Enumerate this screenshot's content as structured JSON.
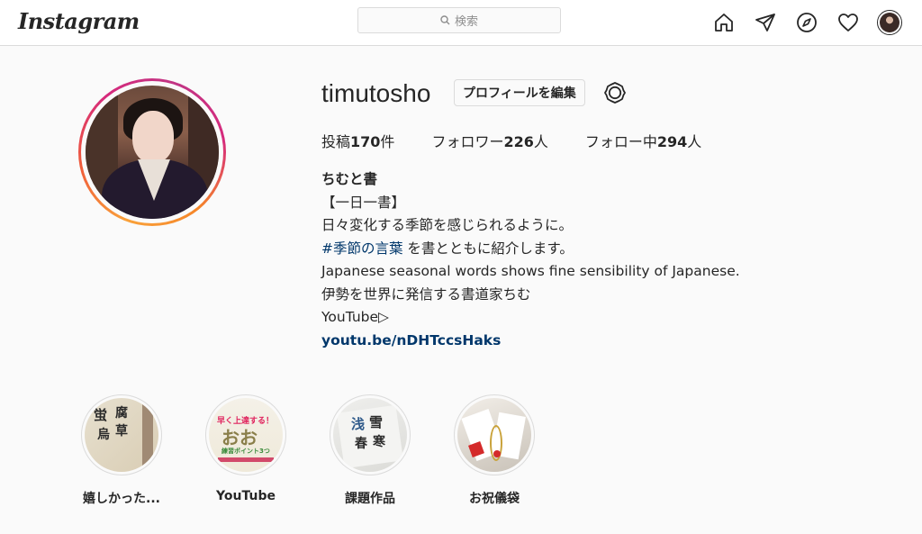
{
  "nav": {
    "logo": "Instagram",
    "search_placeholder": "検索",
    "icons": [
      "home-icon",
      "direct-icon",
      "explore-icon",
      "activity-heart-icon",
      "profile-avatar"
    ]
  },
  "profile": {
    "username": "timutosho",
    "edit_button": "プロフィールを編集",
    "stats": [
      {
        "label": "投稿",
        "value": "170",
        "suffix": "件"
      },
      {
        "label": "フォロワー",
        "value": "226",
        "suffix": "人"
      },
      {
        "label": "フォロー中",
        "value": "294",
        "suffix": "人"
      }
    ],
    "bio": {
      "name": "ちむと書",
      "line1": "【一日一書】",
      "line2": "日々変化する季節を感じられるように。",
      "hashtag": "#季節の言葉",
      "line3_rest": " を書とともに紹介します。",
      "line4": "Japanese seasonal words shows fine sensibility of Japanese.",
      "line5": "伊勢を世界に発信する書道家ちむ",
      "line6": "YouTube▷",
      "link": "youtu.be/nDHTccsHaks"
    }
  },
  "highlights": [
    {
      "label": "嬉しかった..."
    },
    {
      "label": "YouTube",
      "thumb_text_top": "早く上達する！",
      "thumb_text_mid": "おお",
      "thumb_text_bottom": "練習ポイント3つ"
    },
    {
      "label": "課題作品"
    },
    {
      "label": "お祝儀袋"
    }
  ],
  "colors": {
    "link": "#00376b",
    "text": "#262626",
    "border": "#dbdbdb",
    "background": "#fafafa"
  }
}
